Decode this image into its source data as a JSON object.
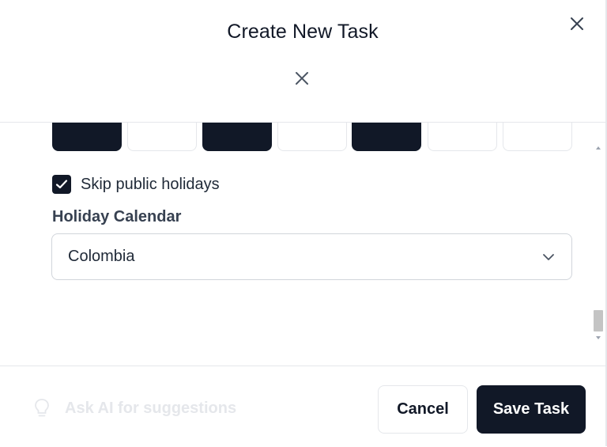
{
  "modal": {
    "title": "Create New Task"
  },
  "recurrence": {
    "weekday_buttons": [
      {
        "selected": true
      },
      {
        "selected": false
      },
      {
        "selected": true
      },
      {
        "selected": false
      },
      {
        "selected": true
      },
      {
        "selected": false
      },
      {
        "selected": false
      }
    ],
    "skip_holidays": {
      "label": "Skip public holidays",
      "checked": true
    },
    "holiday_calendar": {
      "label": "Holiday Calendar",
      "value": "Colombia"
    }
  },
  "footer": {
    "ai_label": "Ask AI for suggestions",
    "cancel_label": "Cancel",
    "save_label": "Save Task"
  },
  "colors": {
    "primary": "#111827",
    "border": "#e5e7eb",
    "muted_text": "#e5e7eb"
  },
  "icons": {
    "close": "close-icon",
    "checkbox": "check-icon",
    "dropdown": "chevron-down-icon",
    "ai": "lightbulb-icon"
  }
}
